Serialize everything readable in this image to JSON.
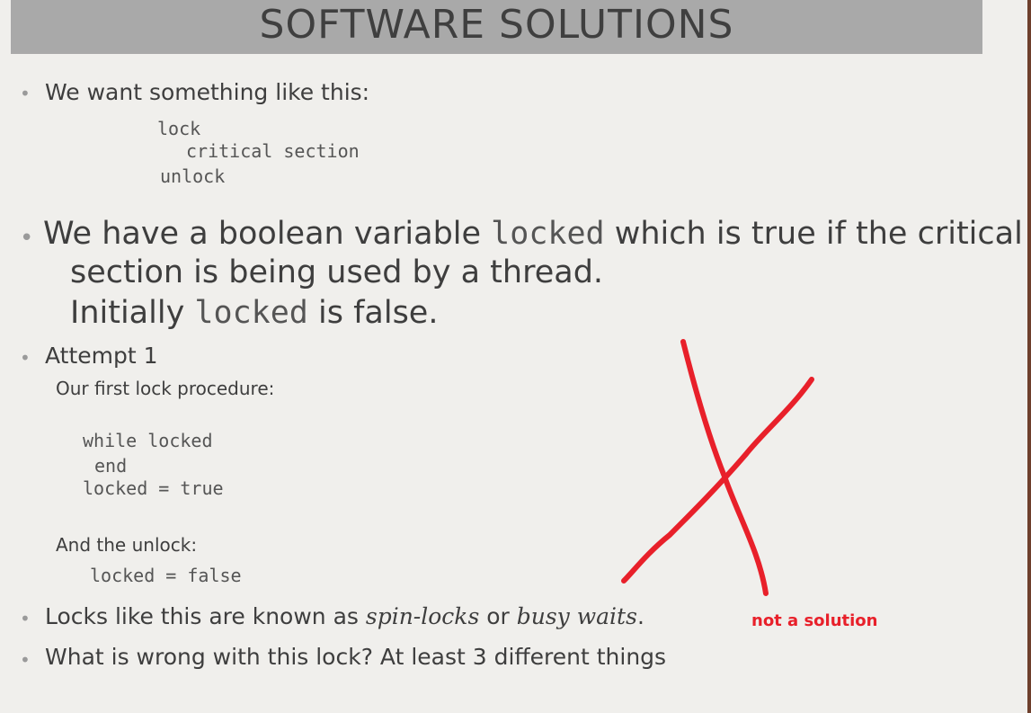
{
  "title": "SOFTWARE SOLUTIONS",
  "bullet1": "We want something like this:",
  "code_lock": "lock",
  "code_critical": "critical section",
  "code_unlock": "unlock",
  "bullet2": {
    "part1": "We have a boolean variable ",
    "var1": "locked",
    "part2": " which is true if the critical",
    "line2": "section is being used by a thread.",
    "line3a": "Initially ",
    "var2": "locked",
    "line3b": " is false."
  },
  "attempt_title": "Attempt 1",
  "attempt_sub": "Our first lock procedure:",
  "code_while": "while locked",
  "code_end": "end",
  "code_set_true": "locked = true",
  "unlock_label": "And the unlock:",
  "code_set_false": "locked = false",
  "bullet4": {
    "part1": "Locks like this are known as ",
    "term1": "spin-locks",
    "part2": " or ",
    "term2": "busy waits",
    "part3": "."
  },
  "bullet5": "What is wrong with this lock? At least 3 different things",
  "annotation": "not a solution",
  "colors": {
    "title_bar": "#a9a9a9",
    "annotation_red": "#e8202a",
    "border": "#6e3f2c"
  }
}
